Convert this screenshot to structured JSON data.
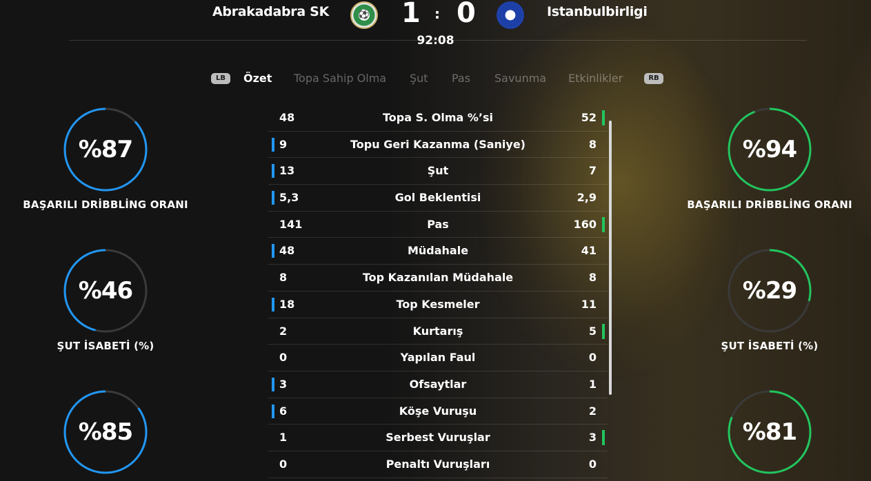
{
  "header": {
    "home_team": "Abrakadabra SK",
    "away_team": "Istanbulbirligi",
    "home_score": "1",
    "separator": ":",
    "away_score": "0",
    "clock": "92:08",
    "home_crest_icon": "club-crest-green-icon",
    "away_crest_icon": "club-crest-blue-icon"
  },
  "tabs": {
    "left_button": "LB",
    "right_button": "RB",
    "items": [
      "Özet",
      "Topa Sahip Olma",
      "Şut",
      "Pas",
      "Savunma",
      "Etkinlikler"
    ],
    "active": "Özet"
  },
  "colors": {
    "home_accent": "#2196f3",
    "away_accent": "#22c55e",
    "ring_track": "#3a3a3a"
  },
  "left_gauges": [
    {
      "value": "%87",
      "label": "BAŞARILI DRİBBLİNG ORANI",
      "percent": 87
    },
    {
      "value": "%46",
      "label": "ŞUT İSABETİ (%)",
      "percent": 46
    },
    {
      "value": "%85",
      "label": "",
      "percent": 85
    }
  ],
  "right_gauges": [
    {
      "value": "%94",
      "label": "BAŞARILI DRİBBLİNG ORANI",
      "percent": 94
    },
    {
      "value": "%29",
      "label": "ŞUT İSABETİ (%)",
      "percent": 29
    },
    {
      "value": "%81",
      "label": "",
      "percent": 81
    }
  ],
  "stats": [
    {
      "home": "48",
      "label": "Topa S. Olma %’si",
      "away": "52",
      "leader": "away"
    },
    {
      "home": "9",
      "label": "Topu Geri Kazanma (Saniye)",
      "away": "8",
      "leader": "home"
    },
    {
      "home": "13",
      "label": "Şut",
      "away": "7",
      "leader": "home"
    },
    {
      "home": "5,3",
      "label": "Gol Beklentisi",
      "away": "2,9",
      "leader": "home"
    },
    {
      "home": "141",
      "label": "Pas",
      "away": "160",
      "leader": "away"
    },
    {
      "home": "48",
      "label": "Müdahale",
      "away": "41",
      "leader": "home"
    },
    {
      "home": "8",
      "label": "Top Kazanılan Müdahale",
      "away": "8",
      "leader": "none"
    },
    {
      "home": "18",
      "label": "Top Kesmeler",
      "away": "11",
      "leader": "home"
    },
    {
      "home": "2",
      "label": "Kurtarış",
      "away": "5",
      "leader": "away"
    },
    {
      "home": "0",
      "label": "Yapılan Faul",
      "away": "0",
      "leader": "none"
    },
    {
      "home": "3",
      "label": "Ofsaytlar",
      "away": "1",
      "leader": "home"
    },
    {
      "home": "6",
      "label": "Köşe Vuruşu",
      "away": "2",
      "leader": "home"
    },
    {
      "home": "1",
      "label": "Serbest Vuruşlar",
      "away": "3",
      "leader": "away"
    },
    {
      "home": "0",
      "label": "Penaltı Vuruşları",
      "away": "0",
      "leader": "none"
    }
  ]
}
